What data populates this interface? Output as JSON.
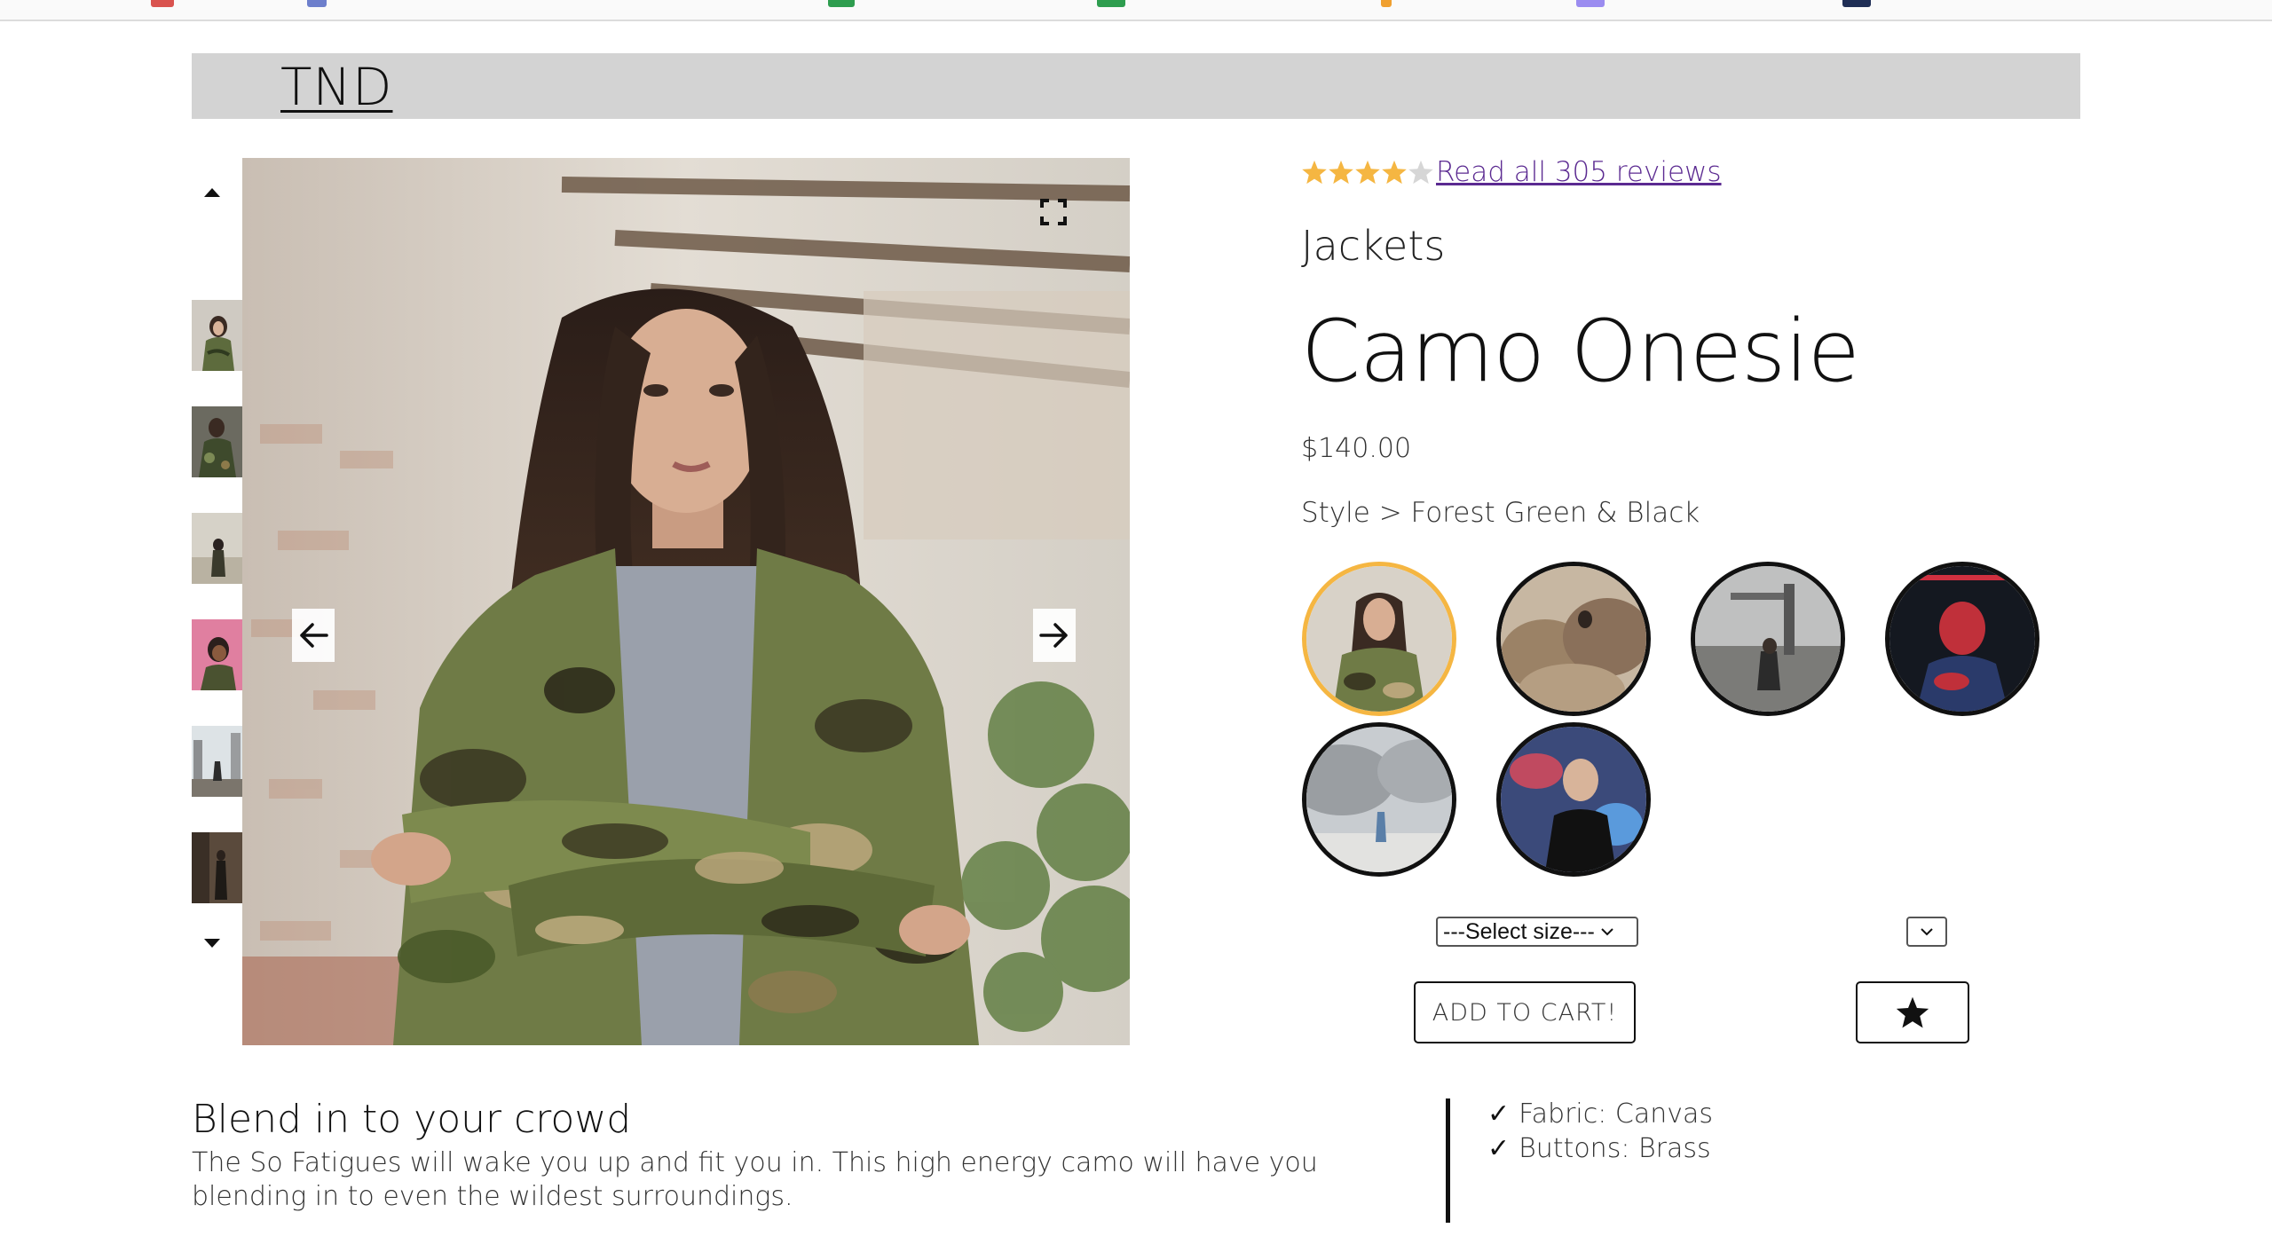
{
  "header": {
    "logo": "TND"
  },
  "gallery": {
    "thumbnails": [
      {
        "name": "thumb-woman-camo"
      },
      {
        "name": "thumb-camo-jacket-2"
      },
      {
        "name": "thumb-figure-outdoors"
      },
      {
        "name": "thumb-woman-pink"
      },
      {
        "name": "thumb-city-scene"
      },
      {
        "name": "thumb-dark-room"
      }
    ]
  },
  "product": {
    "rating": 4,
    "rating_max": 5,
    "reviews_link": "Read all 305 reviews",
    "category": "Jackets",
    "title": "Camo Onesie",
    "price": "$140.00",
    "style_label": "Style > Forest Green & Black",
    "styles": [
      {
        "name": "swatch-camo-woman",
        "selected": true
      },
      {
        "name": "swatch-rocks"
      },
      {
        "name": "swatch-industrial"
      },
      {
        "name": "swatch-red-neon"
      },
      {
        "name": "swatch-foggy-walker"
      },
      {
        "name": "swatch-graffiti-man"
      }
    ],
    "size_select": "---Select size---",
    "qty_select": "",
    "add_to_cart": "ADD TO CART!",
    "favorite_icon": "star-icon"
  },
  "description": {
    "heading": "Blend in to your crowd",
    "body": "The So Fatigues will wake you up and fit you in. This high energy camo will have you blending in to even the wildest surroundings."
  },
  "features": [
    {
      "check": "✓",
      "text": "Fabric: Canvas"
    },
    {
      "check": "✓",
      "text": "Buttons: Brass"
    }
  ],
  "colors": {
    "star_fill": "#f5b642",
    "selected_swatch": "#f5b642",
    "link": "#5b2a91",
    "header_bg": "#d3d3d3"
  }
}
